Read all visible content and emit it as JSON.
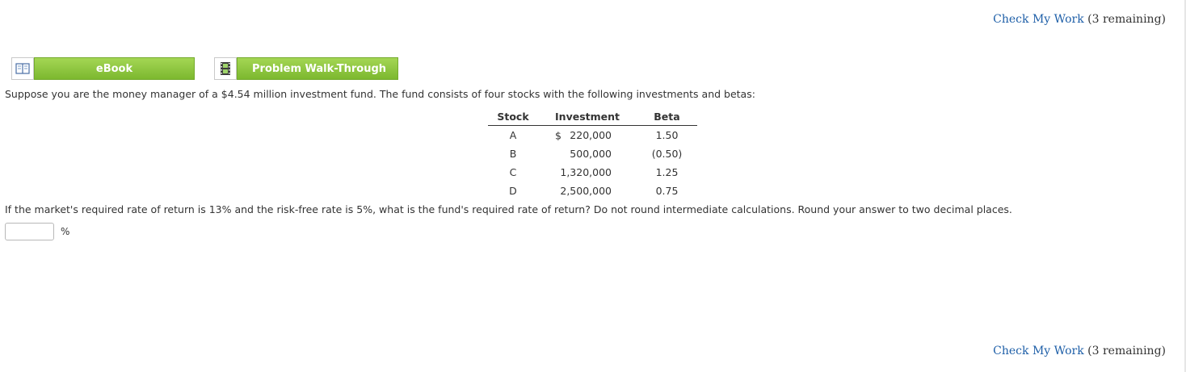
{
  "check_work": {
    "link_label": "Check My Work",
    "remaining": "(3 remaining)"
  },
  "resources": {
    "ebook_label": "eBook",
    "walkthrough_label": "Problem Walk-Through",
    "ebook_icon": "book-icon",
    "walkthrough_icon": "film-icon"
  },
  "problem": {
    "intro": "Suppose you are the money manager of a $4.54 million investment fund. The fund consists of four stocks with the following investments and betas:",
    "table": {
      "headers": [
        "Stock",
        "Investment",
        "Beta"
      ],
      "currency_symbol": "$",
      "rows": [
        {
          "stock": "A",
          "investment": "220,000",
          "beta": "1.50"
        },
        {
          "stock": "B",
          "investment": "500,000",
          "beta": "(0.50)"
        },
        {
          "stock": "C",
          "investment": "1,320,000",
          "beta": "1.25"
        },
        {
          "stock": "D",
          "investment": "2,500,000",
          "beta": "0.75"
        }
      ]
    },
    "question": "If the market's required rate of return is 13% and the risk-free rate is 5%, what is the fund's required rate of return? Do not round intermediate calculations. Round your answer to two decimal places.",
    "answer": {
      "value": "",
      "unit": "%"
    }
  },
  "colors": {
    "link": "#1e5fa8",
    "button_green": "#8bc53f",
    "text": "#333333"
  }
}
